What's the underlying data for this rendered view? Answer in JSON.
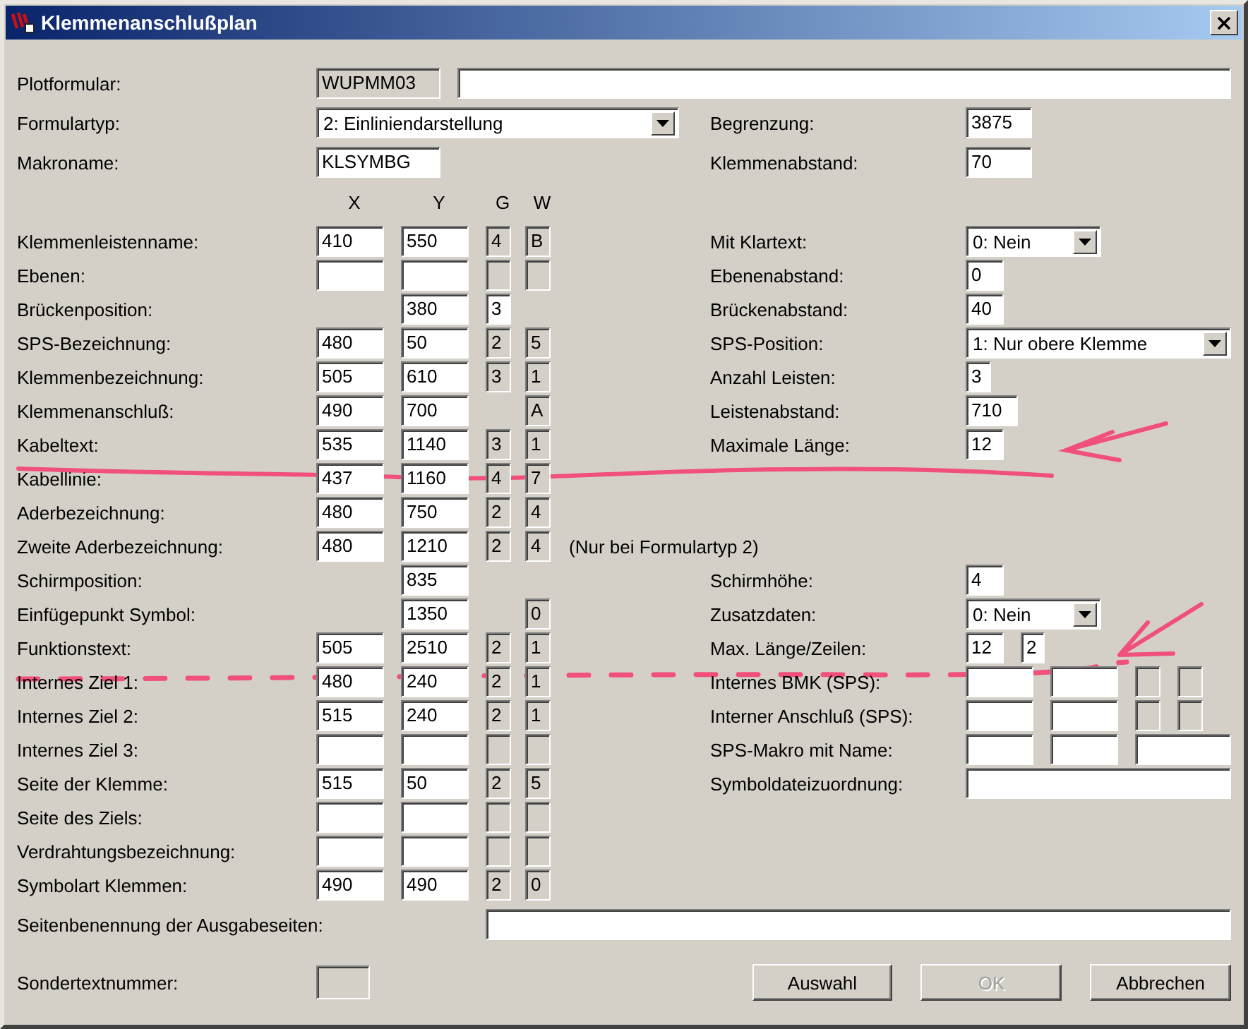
{
  "window": {
    "title": "Klemmenanschlußplan"
  },
  "plotformular": {
    "label": "Plotformular:",
    "fields": [
      {
        "value": "WUPMM03",
        "disabled": true
      },
      {
        "disabled": false
      }
    ]
  },
  "formulartyp": {
    "label": "Formulartyp:",
    "value": "2: Einliniendarstellung"
  },
  "makroname": {
    "label": "Makroname:",
    "field": {
      "value": "KLSYMBG",
      "disabled": false
    }
  },
  "top_right": [
    {
      "label": "Begrenzung:",
      "field": {
        "value": "3875",
        "disabled": false
      }
    },
    {
      "label": "Klemmenabstand:",
      "field": {
        "value": "70",
        "disabled": false
      }
    }
  ],
  "columns": [
    "X",
    "Y",
    "G",
    "W"
  ],
  "rows": [
    {
      "label": "Klemmenleistenname:",
      "x": {
        "value": "410",
        "disabled": false
      },
      "y": {
        "value": "550",
        "disabled": false
      },
      "g": {
        "value": "4",
        "disabled": true
      },
      "w": {
        "value": "B",
        "disabled": true
      },
      "right": {
        "kind": "combo",
        "label": "Mit Klartext:",
        "value": "0: Nein"
      }
    },
    {
      "label": "Ebenen:",
      "x": {
        "disabled": false
      },
      "y": {
        "disabled": false
      },
      "g": {
        "disabled": true
      },
      "w": {
        "disabled": true
      },
      "right": {
        "kind": "text",
        "label": "Ebenenabstand:",
        "fields": [
          {
            "value": "0",
            "disabled": false
          }
        ]
      }
    },
    {
      "label": "Brückenposition:",
      "y": {
        "value": "380",
        "disabled": false
      },
      "g": {
        "value": "3",
        "disabled": false
      },
      "right": {
        "kind": "text",
        "label": "Brückenabstand:",
        "fields": [
          {
            "value": "40",
            "disabled": false
          }
        ]
      }
    },
    {
      "label": "SPS-Bezeichnung:",
      "x": {
        "value": "480",
        "disabled": false
      },
      "y": {
        "value": "50",
        "disabled": false
      },
      "g": {
        "value": "2",
        "disabled": true
      },
      "w": {
        "value": "5",
        "disabled": true
      },
      "right": {
        "kind": "combo",
        "label": "SPS-Position:",
        "value": "1: Nur obere Klemme"
      }
    },
    {
      "label": "Klemmenbezeichnung:",
      "x": {
        "value": "505",
        "disabled": false
      },
      "y": {
        "value": "610",
        "disabled": false
      },
      "g": {
        "value": "3",
        "disabled": true
      },
      "w": {
        "value": "1",
        "disabled": true
      },
      "right": {
        "kind": "text",
        "label": "Anzahl Leisten:",
        "fields": [
          {
            "value": "3",
            "disabled": false
          }
        ]
      }
    },
    {
      "label": "Klemmenanschluß:",
      "x": {
        "value": "490",
        "disabled": false
      },
      "y": {
        "value": "700",
        "disabled": false
      },
      "w": {
        "value": "A",
        "disabled": true
      },
      "right": {
        "kind": "text",
        "label": "Leistenabstand:",
        "fields": [
          {
            "value": "710",
            "disabled": false
          }
        ]
      }
    },
    {
      "label": "Kabeltext:",
      "x": {
        "value": "535",
        "disabled": false
      },
      "y": {
        "value": "1140",
        "disabled": false
      },
      "g": {
        "value": "3",
        "disabled": true
      },
      "w": {
        "value": "1",
        "disabled": true
      },
      "right": {
        "kind": "text",
        "label": "Maximale Länge:",
        "fields": [
          {
            "value": "12",
            "disabled": false
          }
        ]
      }
    },
    {
      "label": "Kabellinie:",
      "x": {
        "value": "437",
        "disabled": false
      },
      "y": {
        "value": "1160",
        "disabled": false
      },
      "g": {
        "value": "4",
        "disabled": true
      },
      "w": {
        "value": "7",
        "disabled": true
      }
    },
    {
      "label": "Aderbezeichnung:",
      "x": {
        "value": "480",
        "disabled": false
      },
      "y": {
        "value": "750",
        "disabled": false
      },
      "g": {
        "value": "2",
        "disabled": true
      },
      "w": {
        "value": "4",
        "disabled": true
      }
    },
    {
      "label": "Zweite Aderbezeichnung:",
      "x": {
        "value": "480",
        "disabled": false
      },
      "y": {
        "value": "1210",
        "disabled": false
      },
      "g": {
        "value": "2",
        "disabled": true
      },
      "w": {
        "value": "4",
        "disabled": true
      },
      "note": "(Nur bei Formulartyp 2)"
    },
    {
      "label": "Schirmposition:",
      "y": {
        "value": "835",
        "disabled": false
      },
      "right": {
        "kind": "text",
        "label": "Schirmhöhe:",
        "fields": [
          {
            "value": "4",
            "disabled": false
          }
        ]
      }
    },
    {
      "label": "Einfügepunkt Symbol:",
      "y": {
        "value": "1350",
        "disabled": false
      },
      "w": {
        "value": "0",
        "disabled": true
      },
      "right": {
        "kind": "combo",
        "label": "Zusatzdaten:",
        "value": "0: Nein"
      }
    },
    {
      "label": "Funktionstext:",
      "x": {
        "value": "505",
        "disabled": false
      },
      "y": {
        "value": "2510",
        "disabled": false
      },
      "g": {
        "value": "2",
        "disabled": true
      },
      "w": {
        "value": "1",
        "disabled": true
      },
      "right": {
        "kind": "text",
        "label": "Max. Länge/Zeilen:",
        "fields": [
          {
            "value": "12",
            "disabled": false
          },
          {
            "value": "2",
            "disabled": false
          }
        ]
      }
    },
    {
      "label": "Internes Ziel 1:",
      "x": {
        "value": "480",
        "disabled": false
      },
      "y": {
        "value": "240",
        "disabled": false
      },
      "g": {
        "value": "2",
        "disabled": true
      },
      "w": {
        "value": "1",
        "disabled": true
      },
      "right": {
        "kind": "text",
        "label": "Internes BMK (SPS):",
        "fields": [
          {
            "disabled": false
          },
          {
            "disabled": false
          },
          {
            "disabled": true
          },
          {
            "disabled": true
          }
        ]
      }
    },
    {
      "label": "Internes Ziel 2:",
      "x": {
        "value": "515",
        "disabled": false
      },
      "y": {
        "value": "240",
        "disabled": false
      },
      "g": {
        "value": "2",
        "disabled": true
      },
      "w": {
        "value": "1",
        "disabled": true
      },
      "right": {
        "kind": "text",
        "label": "Interner Anschluß (SPS):",
        "fields": [
          {
            "disabled": false
          },
          {
            "disabled": false
          },
          {
            "disabled": true
          },
          {
            "disabled": true
          }
        ]
      }
    },
    {
      "label": "Internes Ziel 3:",
      "x": {
        "disabled": false
      },
      "y": {
        "disabled": false
      },
      "g": {
        "disabled": true
      },
      "w": {
        "disabled": true
      },
      "right": {
        "kind": "text",
        "label": "SPS-Makro mit Name:",
        "fields": [
          {
            "disabled": false
          },
          {
            "disabled": false
          },
          {
            "disabled": false
          }
        ]
      }
    },
    {
      "label": "Seite der Klemme:",
      "x": {
        "value": "515",
        "disabled": false
      },
      "y": {
        "value": "50",
        "disabled": false
      },
      "g": {
        "value": "2",
        "disabled": true
      },
      "w": {
        "value": "5",
        "disabled": true
      },
      "right": {
        "kind": "text",
        "label": "Symboldateizuordnung:",
        "fields": [
          {
            "disabled": false
          }
        ]
      }
    },
    {
      "label": "Seite des Ziels:",
      "x": {
        "disabled": false
      },
      "y": {
        "disabled": false
      },
      "g": {
        "disabled": true
      },
      "w": {
        "disabled": true
      }
    },
    {
      "label": "Verdrahtungsbezeichnung:",
      "x": {
        "disabled": false
      },
      "y": {
        "disabled": false
      },
      "g": {
        "disabled": true
      },
      "w": {
        "disabled": true
      }
    },
    {
      "label": "Symbolart Klemmen:",
      "x": {
        "value": "490",
        "disabled": false
      },
      "y": {
        "value": "490",
        "disabled": false
      },
      "g": {
        "value": "2",
        "disabled": true
      },
      "w": {
        "value": "0",
        "disabled": true
      }
    }
  ],
  "seitenbenennung": {
    "label": "Seitenbenennung der Ausgabeseiten:",
    "field": {
      "disabled": false
    }
  },
  "sondertextnummer": {
    "label": "Sondertextnummer:",
    "field": {
      "disabled": true
    }
  },
  "buttons": [
    {
      "label": "Auswahl",
      "disabled": false
    },
    {
      "label": "OK",
      "disabled": true
    },
    {
      "label": "Abbrechen",
      "disabled": false
    }
  ]
}
